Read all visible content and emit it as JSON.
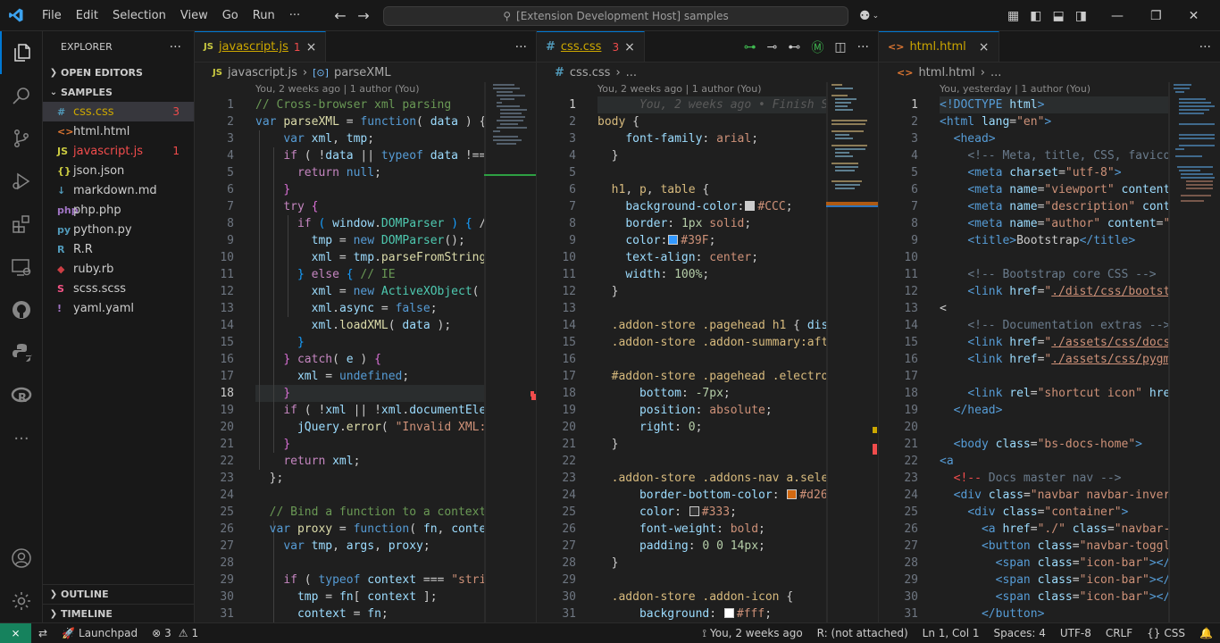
{
  "menu": [
    "File",
    "Edit",
    "Selection",
    "View",
    "Go",
    "Run",
    "···"
  ],
  "search": "[Extension Development Host] samples",
  "sidebar": {
    "title": "EXPLORER",
    "open_editors": "OPEN EDITORS",
    "samples": "SAMPLES",
    "files": [
      {
        "icon": "#",
        "name": "css.css",
        "badge": "3",
        "color": "#519aba"
      },
      {
        "icon": "<>",
        "name": "html.html",
        "badge": "",
        "color": "#e37933"
      },
      {
        "icon": "JS",
        "name": "javascript.js",
        "badge": "1",
        "color": "#cbcb41"
      },
      {
        "icon": "{}",
        "name": "json.json",
        "badge": "",
        "color": "#cbcb41"
      },
      {
        "icon": "↓",
        "name": "markdown.md",
        "badge": "",
        "color": "#519aba"
      },
      {
        "icon": "php",
        "name": "php.php",
        "badge": "",
        "color": "#a074c4"
      },
      {
        "icon": "py",
        "name": "python.py",
        "badge": "",
        "color": "#519aba"
      },
      {
        "icon": "R",
        "name": "R.R",
        "badge": "",
        "color": "#519aba"
      },
      {
        "icon": "◆",
        "name": "ruby.rb",
        "badge": "",
        "color": "#cc3e44"
      },
      {
        "icon": "S",
        "name": "scss.scss",
        "badge": "",
        "color": "#f55385"
      },
      {
        "icon": "!",
        "name": "yaml.yaml",
        "badge": "",
        "color": "#a074c4"
      }
    ],
    "outline": "OUTLINE",
    "timeline": "TIMELINE"
  },
  "editors": {
    "js": {
      "tab": "javascript.js",
      "tab_badge": "1",
      "tab_icon": "JS",
      "breadcrumb_file": "javascript.js",
      "breadcrumb_symbol": "parseXML",
      "blame": "You, 2 weeks ago | 1 author (You)"
    },
    "css": {
      "tab": "css.css",
      "tab_badge": "3",
      "tab_icon": "#",
      "breadcrumb_file": "css.css",
      "breadcrumb_more": "...",
      "blame": "You, 2 weeks ago | 1 author (You)"
    },
    "html": {
      "tab": "html.html",
      "tab_icon": "<>",
      "breadcrumb_file": "html.html",
      "breadcrumb_more": "...",
      "blame": "You, yesterday | 1 author (You)"
    }
  },
  "status": {
    "launchpad": "Launchpad",
    "errors": "3",
    "warnings": "1",
    "blame": "You, 2 weeks ago",
    "r": "R: (not attached)",
    "position": "Ln 1, Col 1",
    "spaces": "Spaces: 4",
    "encoding": "UTF-8",
    "eol": "CRLF",
    "language": "CSS",
    "language_icon": "{}"
  },
  "colors": {
    "accent": "#0078d4",
    "remote": "#16825d",
    "error": "#f14c4c"
  }
}
